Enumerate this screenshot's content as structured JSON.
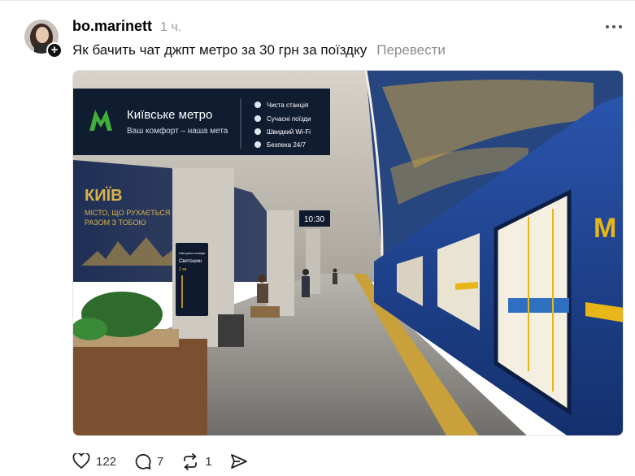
{
  "post": {
    "username": "bo.marinett",
    "time": "1 ч.",
    "text": "Як бачить чат джпт метро за 30 грн за поїздку",
    "translate_label": "Перевести"
  },
  "image": {
    "sign_logo": "М",
    "sign_title": "Київське метро",
    "sign_subtitle": "Ваш комфорт – наша мета",
    "sign_features": [
      "Чиста станція",
      "Сучасні поїзди",
      "Швидкий Wi-Fi",
      "Безпека 24/7"
    ],
    "wall_title": "КИЇВ",
    "wall_slogan_1": "МІСТО, ЩО РУХАЄТЬСЯ",
    "wall_slogan_2": "РАЗОМ З ТОБОЮ",
    "clock": "10:30",
    "screen_title": "Наступна станція",
    "screen_station": "Святошин",
    "screen_eta": "2 хв",
    "train_logo": "М"
  },
  "actions": {
    "likes": "122",
    "comments": "7",
    "reposts": "1"
  },
  "colors": {
    "train_blue": "#1c3f8c",
    "metro_green": "#3fae3a",
    "accent_yellow": "#e8b619"
  }
}
